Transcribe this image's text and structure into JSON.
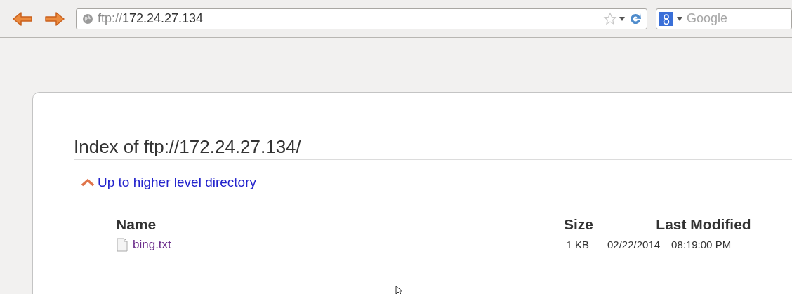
{
  "toolbar": {
    "url_scheme": "ftp://",
    "url_host": "172.24.27.134",
    "search_placeholder": "Google"
  },
  "page": {
    "heading": "Index of ftp://172.24.27.134/",
    "up_link": "Up to higher level directory",
    "columns": [
      "Name",
      "Size",
      "Last Modified"
    ],
    "rows": [
      {
        "name": "bing.txt",
        "size": "1 KB",
        "date": "02/22/2014",
        "time": "08:19:00 PM"
      }
    ]
  }
}
